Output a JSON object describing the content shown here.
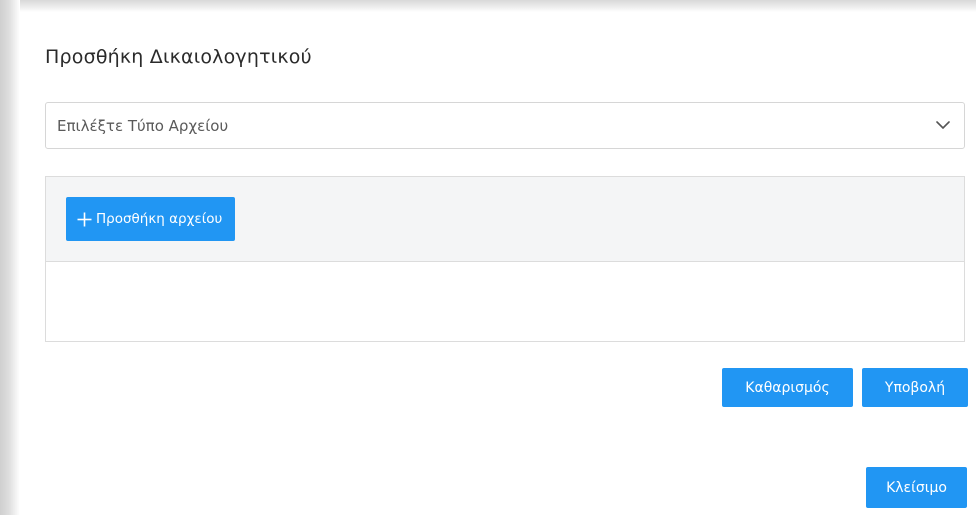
{
  "modal": {
    "title": "Προσθήκη Δικαιολογητικού"
  },
  "file_type_select": {
    "selected_text": "Επιλέξτε Τύπο Αρχείου",
    "icon": "chevron-down-icon"
  },
  "upload": {
    "add_file_label": "Προσθήκη αρχείου",
    "add_icon": "plus-icon"
  },
  "actions": {
    "clear_label": "Καθαρισμός",
    "submit_label": "Υποβολή",
    "close_label": "Κλείσιμο"
  },
  "colors": {
    "primary": "#2196f3",
    "panel_bg": "#f4f5f6",
    "border": "#dcdcdc"
  }
}
